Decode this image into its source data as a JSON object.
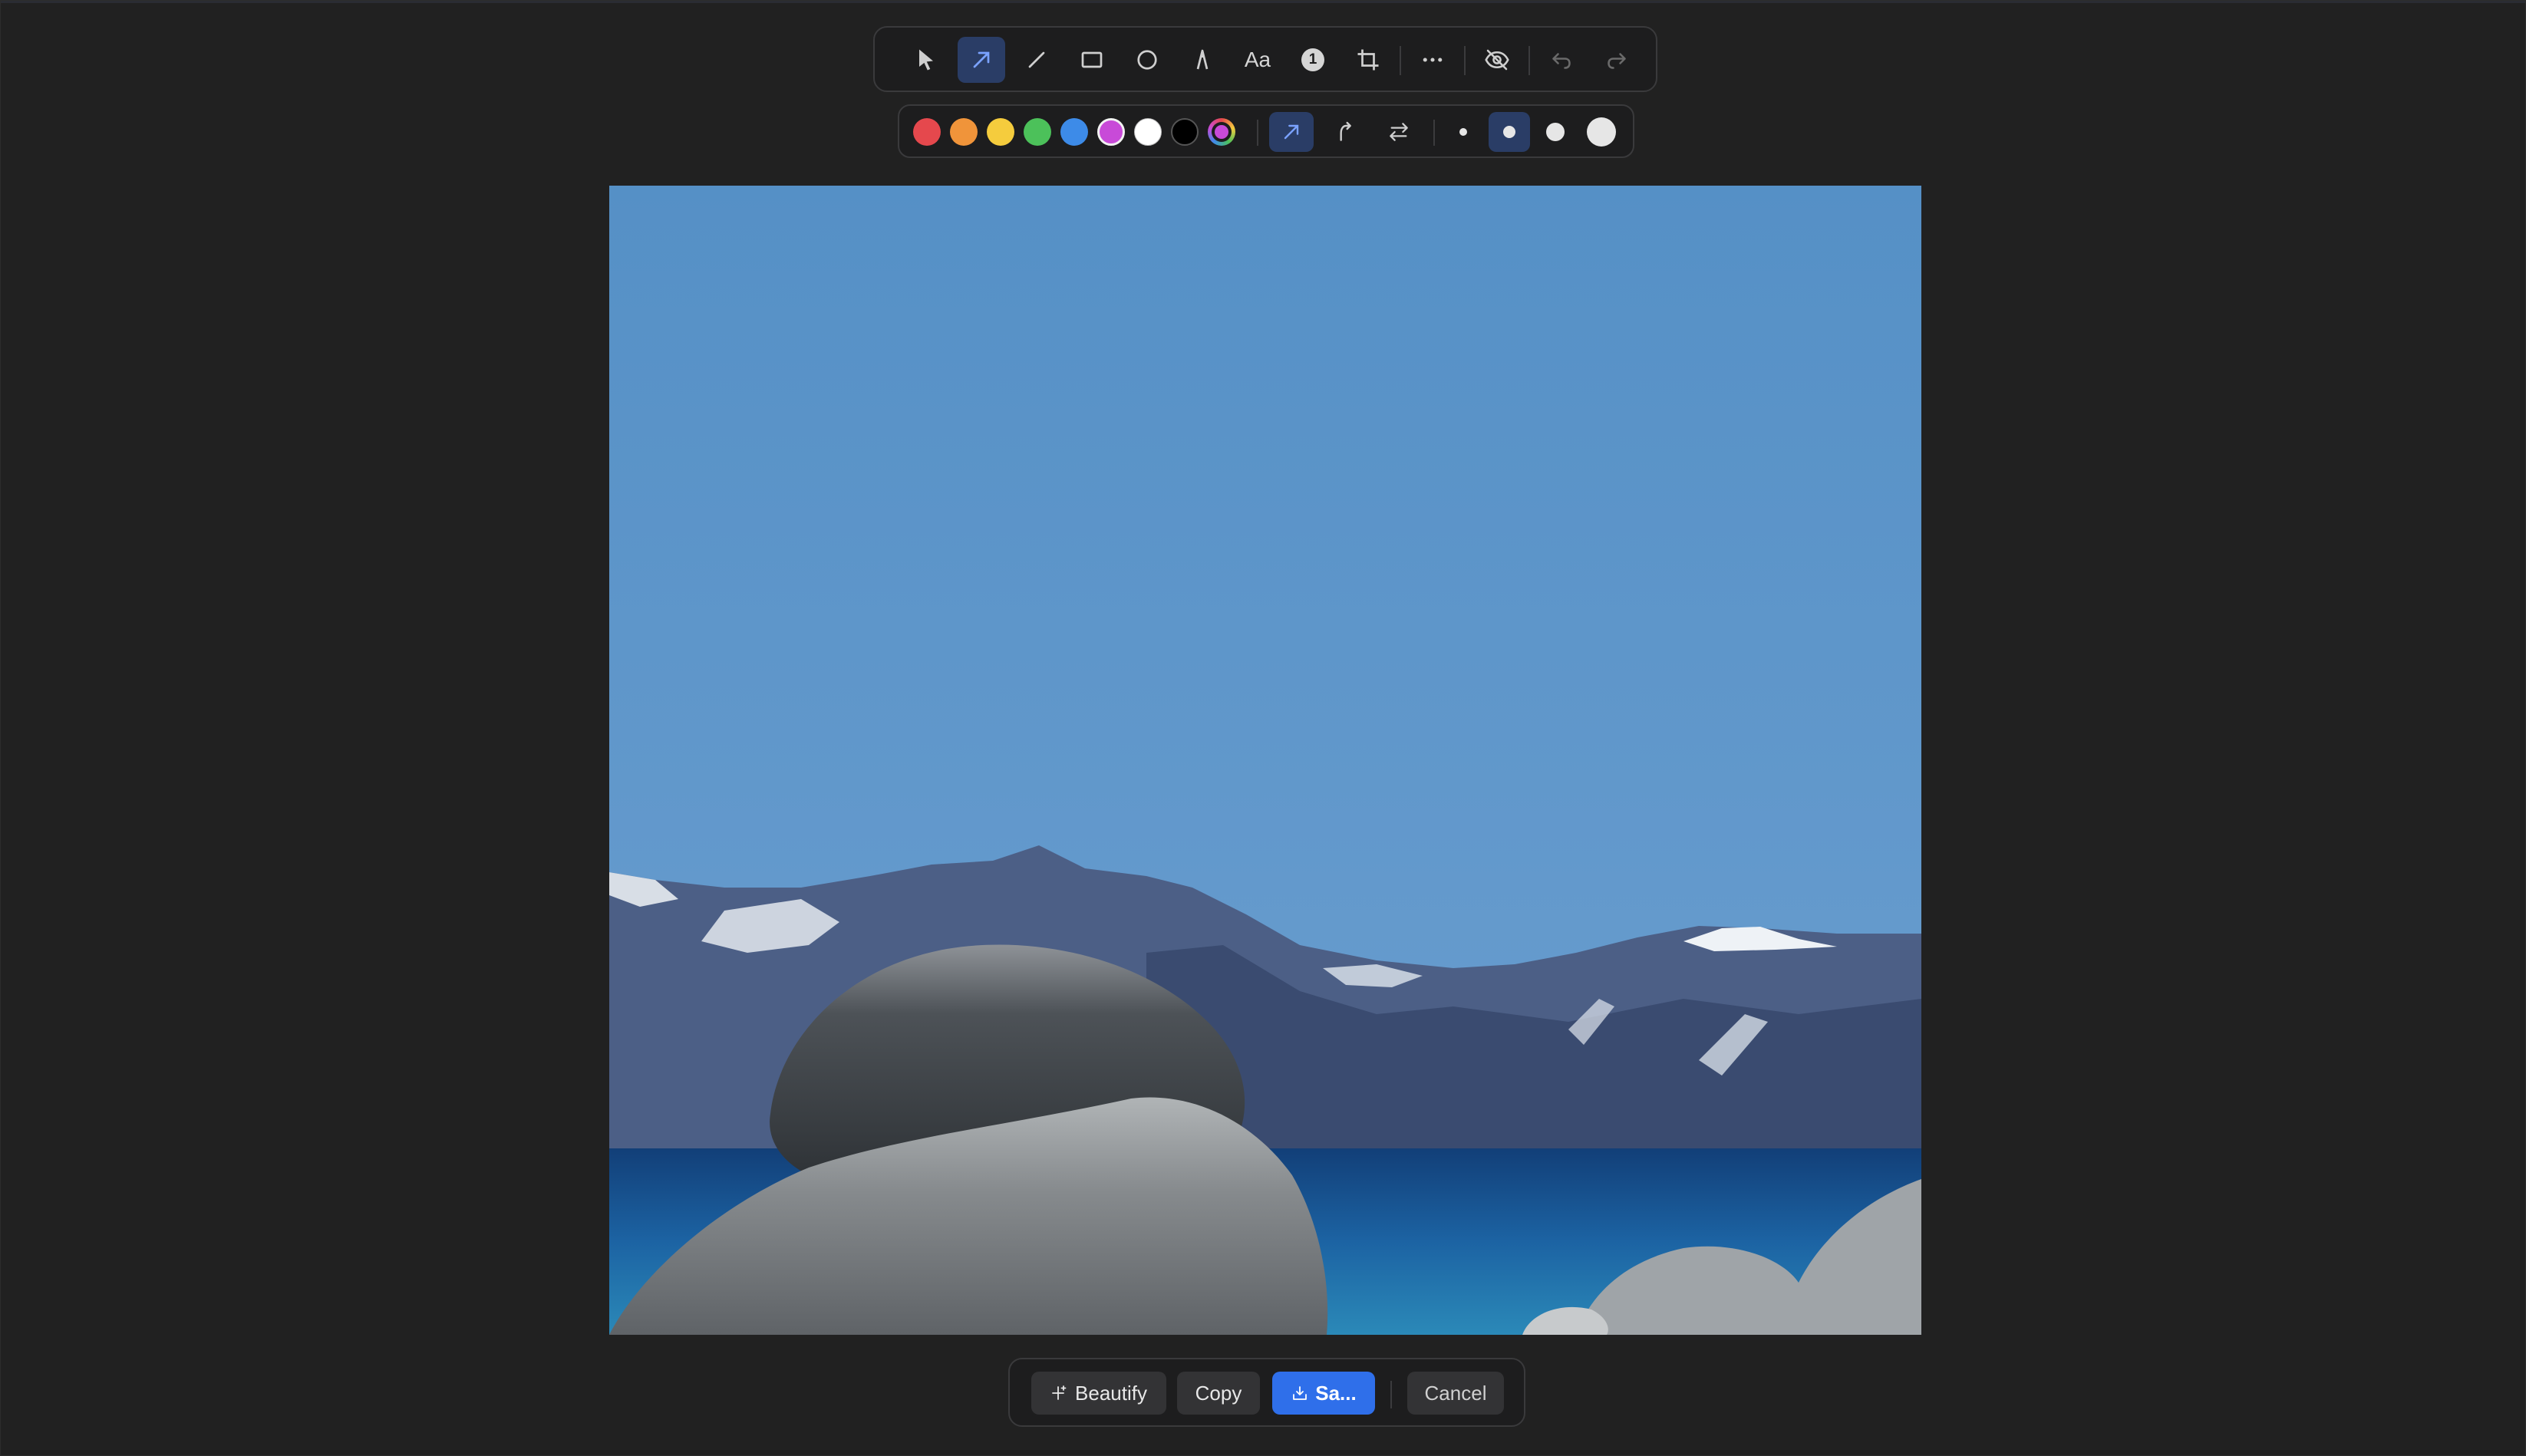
{
  "toolbar": {
    "tools": [
      {
        "id": "select",
        "icon": "pointer-icon",
        "active": false
      },
      {
        "id": "arrow",
        "icon": "arrow-icon",
        "active": true
      },
      {
        "id": "line",
        "icon": "line-icon",
        "active": false
      },
      {
        "id": "rectangle",
        "icon": "rectangle-icon",
        "active": false
      },
      {
        "id": "ellipse",
        "icon": "ellipse-icon",
        "active": false
      },
      {
        "id": "pen",
        "icon": "pen-icon",
        "active": false
      },
      {
        "id": "text",
        "icon": "text-icon",
        "label": "Aa",
        "active": false
      },
      {
        "id": "counter",
        "icon": "counter-icon",
        "label": "1",
        "active": false
      },
      {
        "id": "crop",
        "icon": "crop-icon",
        "active": false
      },
      {
        "id": "more",
        "icon": "more-icon",
        "active": false
      },
      {
        "id": "blur",
        "icon": "eye-off-icon",
        "active": false
      },
      {
        "id": "undo",
        "icon": "undo-icon",
        "active": false
      },
      {
        "id": "redo",
        "icon": "redo-icon",
        "active": false
      }
    ],
    "text_label": "Aa",
    "counter_label": "1"
  },
  "colors": {
    "palette": [
      "#e5484d",
      "#f0943a",
      "#f5cc3d",
      "#4cc15a",
      "#3d8be8",
      "#c84ad8",
      "#ffffff",
      "#000000"
    ],
    "custom_selected": "#c84ad8",
    "accent": "#2f6fea",
    "active_tool_bg": "#2a3d66"
  },
  "arrow_styles": [
    {
      "id": "straight",
      "icon": "straight-arrow-icon",
      "active": true
    },
    {
      "id": "curved",
      "icon": "curved-arrow-icon",
      "active": false
    },
    {
      "id": "double",
      "icon": "double-arrow-icon",
      "active": false
    }
  ],
  "stroke_sizes": [
    {
      "id": "small",
      "active": false
    },
    {
      "id": "medium",
      "active": true
    },
    {
      "id": "large",
      "active": false
    },
    {
      "id": "xlarge",
      "active": false
    }
  ],
  "actions": {
    "beautify_label": "Beautify",
    "copy_label": "Copy",
    "save_label": "Sa...",
    "cancel_label": "Cancel"
  }
}
